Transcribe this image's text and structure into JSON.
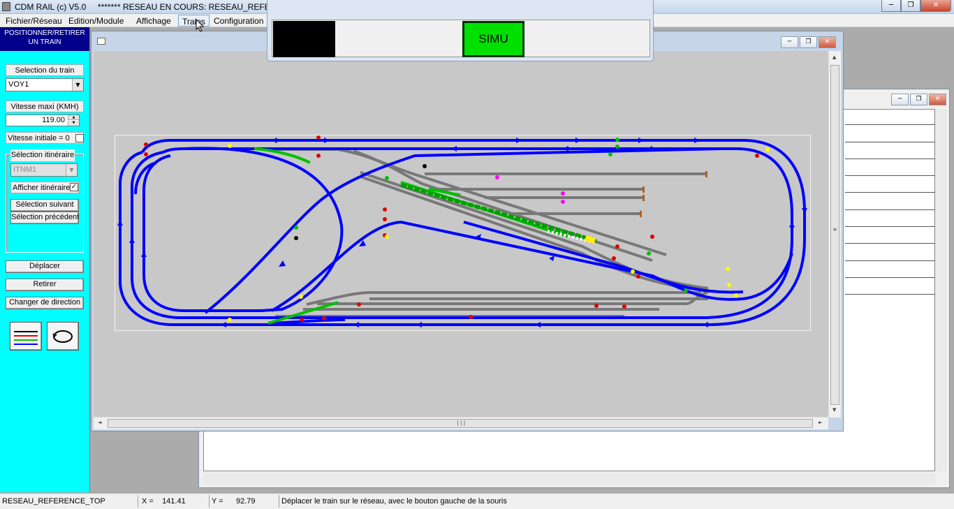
{
  "titlebar": {
    "app_title": "CDM RAIL (c) V5.0",
    "network_title": "******* RESEAU EN COURS: RESEAU_REFERENC"
  },
  "menu": [
    "Fichier/Réseau",
    "Edition/Module",
    "Affichage",
    "Trains",
    "Configuration"
  ],
  "left_panel": {
    "header": "POSITIONNER/RETIRER\nUN TRAIN",
    "train_selection_label": "Selection du train",
    "train_selected": "VOY1",
    "max_speed_label": "Vitesse maxi (KMH)",
    "max_speed_value": "119.00",
    "initial_speed_label": "Vitesse initiale = 0",
    "itinerary_group_label": "Sélection itinéraire",
    "itinerary_selected": "ITNM1",
    "show_itinerary_label": "Afficher itinéraire",
    "show_itinerary_checked": "✓",
    "next_label": "Sélection suivant",
    "previous_label": "Sélection précédent",
    "move_label": "Déplacer",
    "remove_label": "Retirer",
    "change_direction_label": "Changer de direction"
  },
  "simu": {
    "label": "SIMU"
  },
  "statusbar": {
    "network": "RESEAU_REFERENCE_TOP",
    "x_label": "X =",
    "x_value": "141.41",
    "y_label": "Y =",
    "y_value": "92.79",
    "message": "Déplacer le train sur le réseau, avec le bouton gauche de la souris"
  },
  "colors": {
    "panel_bg": "#00ffff",
    "panel_header_bg": "#00008b",
    "track_blue": "#0000ff",
    "track_gray": "#787878",
    "simu_green": "#00e000",
    "canvas_bg": "#c8c8c8"
  }
}
